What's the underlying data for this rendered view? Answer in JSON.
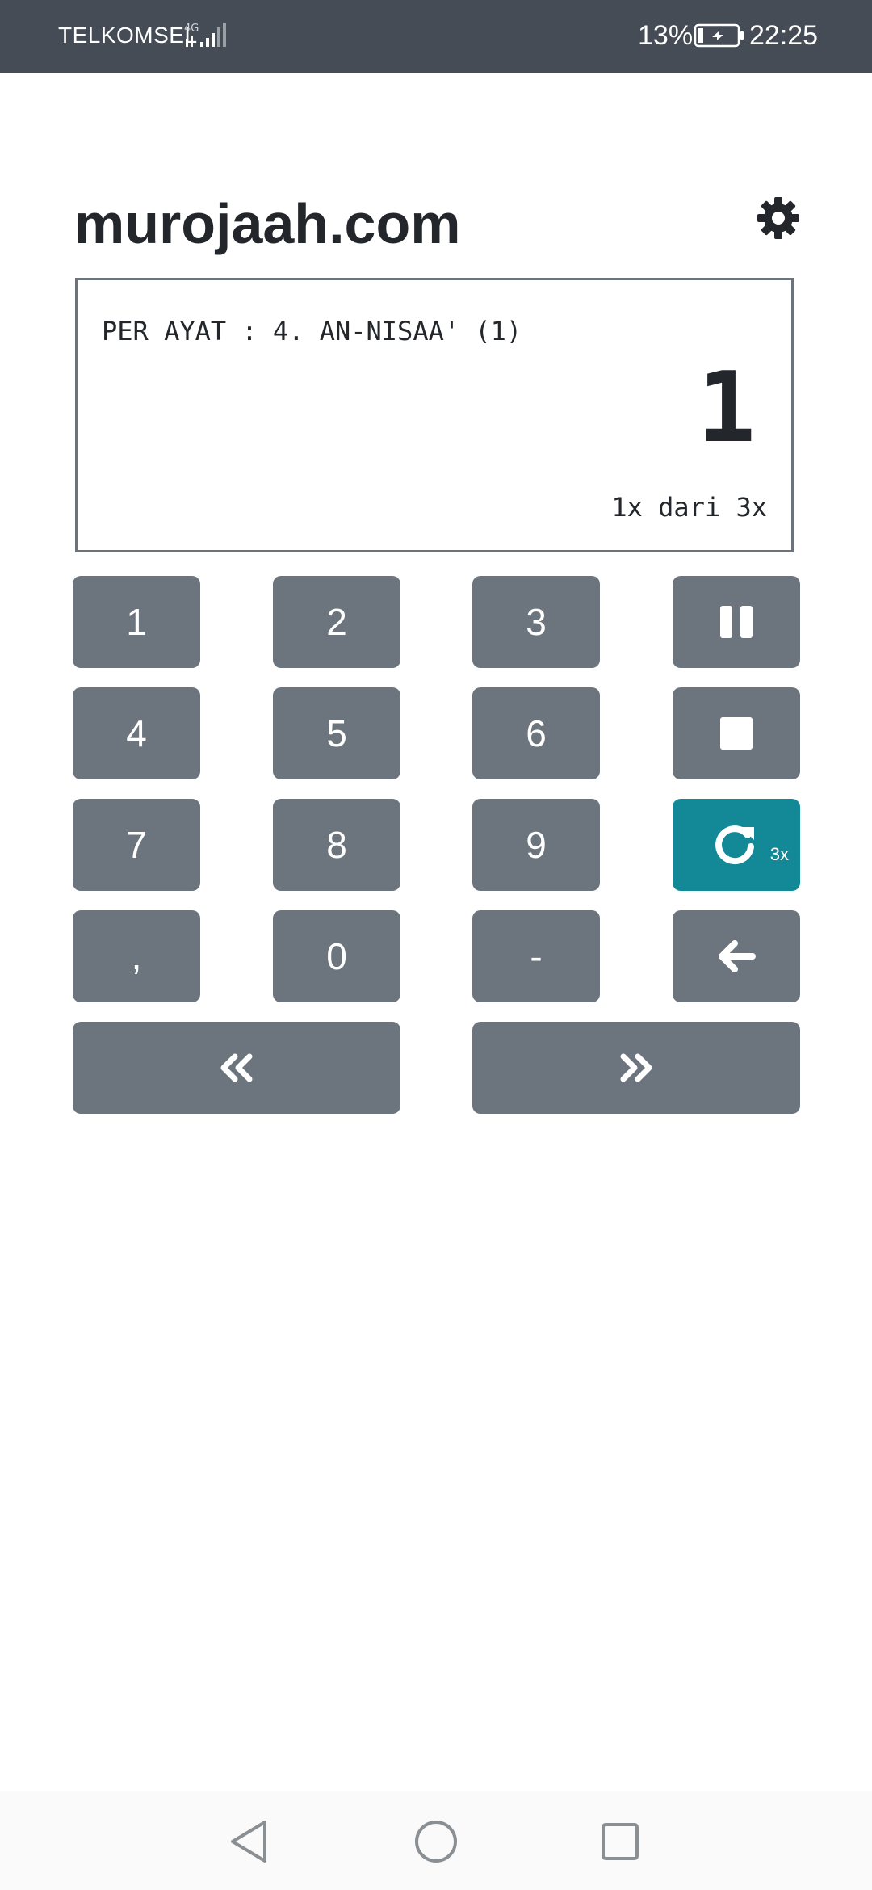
{
  "status_bar": {
    "carrier": "TELKOMSEL",
    "network": "4G",
    "battery": "13%",
    "time": "22:25"
  },
  "header": {
    "title": "murojaah.com",
    "settings_icon": "gear-icon"
  },
  "display": {
    "label": "PER AYAT : 4. AN-NISAA' (1)",
    "number": "1",
    "count": "1x dari 3x"
  },
  "keypad": {
    "digits": [
      "1",
      "2",
      "3",
      "4",
      "5",
      "6",
      "7",
      "8",
      "9",
      ",",
      "0",
      "-"
    ],
    "pause_icon": "pause-icon",
    "stop_icon": "stop-icon",
    "repeat_icon": "repeat-icon",
    "repeat_label": "3x",
    "backspace_icon": "arrow-left-icon",
    "prev_icon": "double-chevron-left-icon",
    "next_icon": "double-chevron-right-icon"
  },
  "colors": {
    "status_bar": "#454c55",
    "key": "#6c757d",
    "key_active": "#138896",
    "text": "#23262b"
  }
}
